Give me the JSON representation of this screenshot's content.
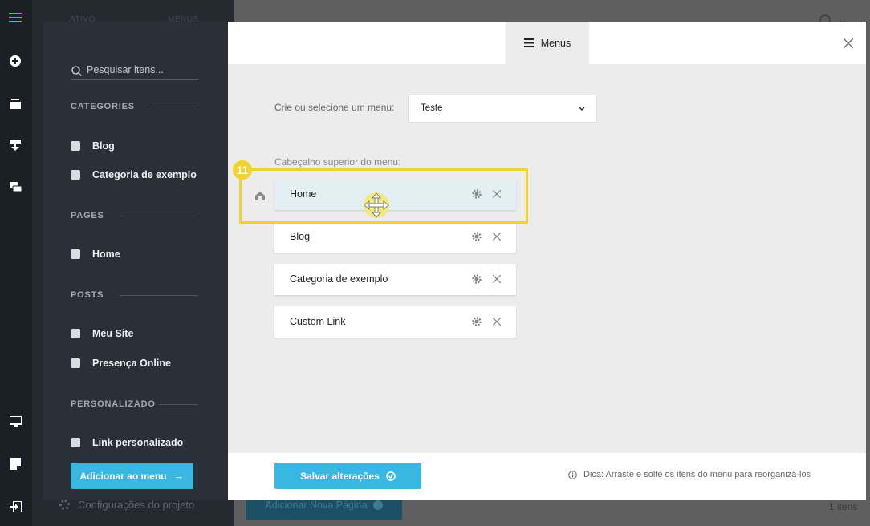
{
  "background": {
    "panel_tabs": [
      "ATIVO",
      "MENUS"
    ],
    "settings_label": "Configurações do projeto",
    "add_page_label": "Adicionar Nova Página",
    "count_label": "1 itens"
  },
  "rail_icons": [
    "menu-icon",
    "add-circle-icon",
    "pages-icon",
    "navigation-icon",
    "comments-icon",
    "monitor-icon",
    "note-icon",
    "logout-icon"
  ],
  "sidebar": {
    "search_placeholder": "Pesquisar itens...",
    "sections": [
      {
        "title": "CATEGORIES",
        "items": [
          "Blog",
          "Categoria de exemplo"
        ]
      },
      {
        "title": "PAGES",
        "items": [
          "Home"
        ]
      },
      {
        "title": "POSTS",
        "items": [
          "Meu Site",
          "Presença Online"
        ]
      },
      {
        "title": "PERSONALIZADO",
        "items": [
          "Link personalizado"
        ]
      }
    ],
    "add_button": "Adicionar ao menu"
  },
  "header": {
    "tab_label": "Menus"
  },
  "main": {
    "select_label": "Crie ou selecione um menu:",
    "select_value": "Teste",
    "menu_header_label": "Cabeçalho superior do menu:",
    "menu_items": [
      "Home",
      "Blog",
      "Categoria de exemplo",
      "Custom Link"
    ],
    "step_badge": "11"
  },
  "footer": {
    "save_button": "Salvar alterações",
    "tip": "Dica: Arraste e solte os itens do menu para reorganizá-los"
  },
  "colors": {
    "accent": "#3ab7e1",
    "highlight": "#f2d22c",
    "sidebar_bg": "#2b3038",
    "rail_bg": "#1b1f26"
  }
}
